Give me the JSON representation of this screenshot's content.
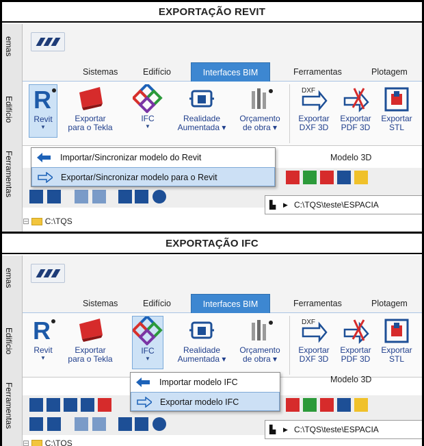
{
  "side_labels": [
    "emas",
    "Edifício",
    "Ferramentas"
  ],
  "tabs": [
    "Sistemas",
    "Edifício",
    "Interfaces BIM",
    "Ferramentas",
    "Plotagem"
  ],
  "ribbon": {
    "revit": "Revit",
    "tekla_1": "Exportar",
    "tekla_2": "para o Tekla",
    "ifc": "IFC",
    "ra_1": "Realidade",
    "ra_2": "Aumentada ▾",
    "orc_1": "Orçamento",
    "orc_2": "de obra ▾",
    "dxf_1": "Exportar",
    "dxf_2": "DXF 3D",
    "pdf_1": "Exportar",
    "pdf_2": "PDF 3D",
    "stl_1": "Exportar",
    "stl_2": "STL",
    "dxf_icon_text": "DXF",
    "group_modelo3d": "Modelo 3D"
  },
  "revit_section": {
    "title": "EXPORTAÇÃO REVIT",
    "menu": [
      {
        "label": "Importar/Sincronizar modelo do Revit",
        "icon": "arrow-left-icon"
      },
      {
        "label": "Exportar/Sincronizar modelo para o Revit",
        "icon": "arrow-right-icon"
      }
    ]
  },
  "ifc_section": {
    "title": "EXPORTAÇÃO IFC",
    "menu": [
      {
        "label": "Importar modelo IFC",
        "icon": "arrow-left-icon"
      },
      {
        "label": "Exportar modelo IFC",
        "icon": "arrow-right-icon"
      }
    ]
  },
  "path": "C:\\TQS\\teste\\ESPACIA",
  "tree_root": "C:\\TQS",
  "colors": {
    "tab_active": "#3d87d1",
    "menu_highlight": "#cce0f5",
    "ribbon_text": "#1f3e8c"
  }
}
